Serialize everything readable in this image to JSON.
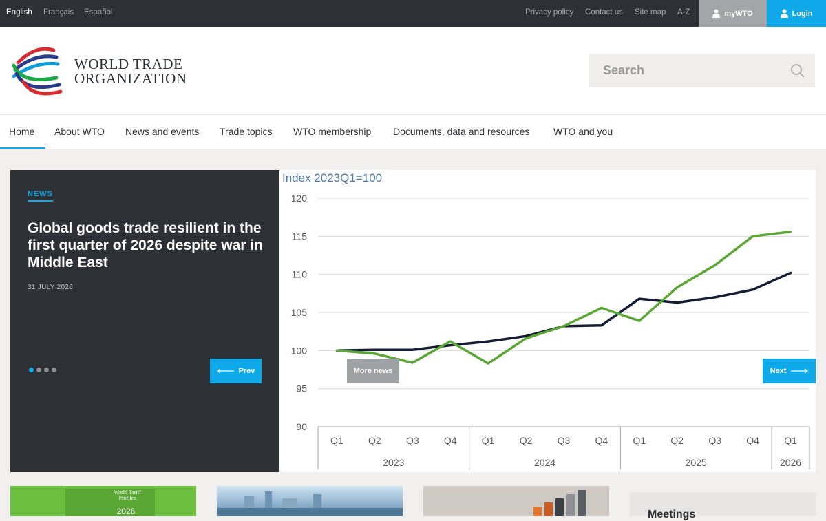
{
  "topbar": {
    "languages": [
      "English",
      "Français",
      "Español"
    ],
    "links": [
      "Privacy policy",
      "Contact us",
      "Site map",
      "A-Z"
    ],
    "mywto": "myWTO",
    "login": "Login"
  },
  "header": {
    "org_line1": "WORLD TRADE",
    "org_line2": "ORGANIZATION",
    "search_placeholder": "Search"
  },
  "nav": [
    "Home",
    "About WTO",
    "News and events",
    "Trade topics",
    "WTO membership",
    "Documents, data and resources",
    "WTO and you"
  ],
  "hero": {
    "tag": "NEWS",
    "headline": "Global goods trade resilient in the first quarter of 2026 despite war in Middle East",
    "date": "31 JULY 2026",
    "prev": "Prev",
    "next": "Next",
    "more_news": "More news"
  },
  "chart_data": {
    "type": "line",
    "title": "Index 2023Q1=100",
    "categories": [
      "Q1",
      "Q2",
      "Q3",
      "Q4",
      "Q1",
      "Q2",
      "Q3",
      "Q4",
      "Q1",
      "Q2",
      "Q3",
      "Q4",
      "Q1"
    ],
    "years": [
      {
        "label": "2023",
        "quarters": 4
      },
      {
        "label": "2024",
        "quarters": 4
      },
      {
        "label": "2025",
        "quarters": 4
      },
      {
        "label": "2026",
        "quarters": 1
      }
    ],
    "ylim": [
      90,
      120
    ],
    "yticks": [
      90,
      95,
      100,
      105,
      110,
      115,
      120
    ],
    "grid": true,
    "series": [
      {
        "color": "#141d33",
        "values": [
          100,
          100.1,
          100.1,
          100.7,
          101.2,
          101.9,
          103.2,
          103.3,
          106.8,
          106.3,
          107.0,
          108.0,
          110.2
        ]
      },
      {
        "color": "#5aa735",
        "values": [
          100,
          99.6,
          98.4,
          101.2,
          98.3,
          101.6,
          103.2,
          105.6,
          103.9,
          108.3,
          111.2,
          115.0,
          115.6
        ]
      }
    ]
  },
  "cards": {
    "meetings": "Meetings",
    "tariff_profiles_title": "World Tariff Profiles",
    "tariff_profiles_year": "2026"
  },
  "colors": {
    "accent": "#0fa9ea",
    "dark": "#2d3035",
    "green": "#5aa735",
    "navy": "#141d33"
  }
}
